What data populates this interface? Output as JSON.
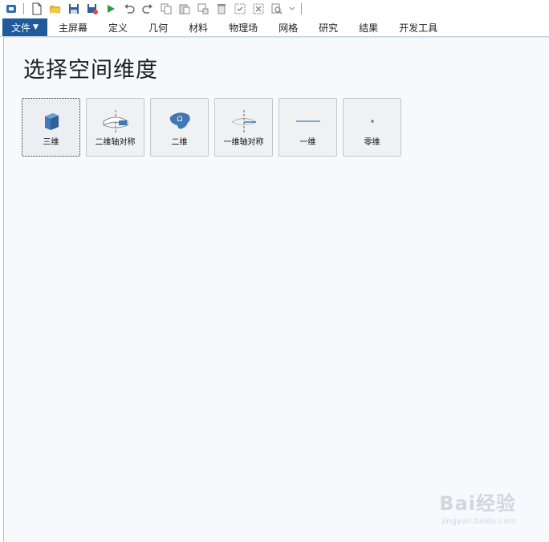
{
  "toolbar": {
    "icons": [
      "app-icon",
      "new-icon",
      "open-icon",
      "save-icon",
      "save-as-icon",
      "run-icon",
      "undo-icon",
      "redo-icon",
      "copy-icon",
      "paste-icon",
      "duplicate-icon",
      "delete-icon",
      "select-all-icon",
      "clear-selection-icon",
      "find-icon",
      "customize-icon"
    ]
  },
  "menubar": {
    "file_label": "文件",
    "tabs": [
      "主屏幕",
      "定义",
      "几何",
      "材料",
      "物理场",
      "网格",
      "研究",
      "结果",
      "开发工具"
    ]
  },
  "page": {
    "title": "选择空间维度"
  },
  "dimensions": [
    {
      "label": "三维",
      "icon": "cube-3d-icon",
      "selected": true
    },
    {
      "label": "二维轴对称",
      "icon": "axisymmetric-2d-icon",
      "selected": false
    },
    {
      "label": "二维",
      "icon": "planar-2d-icon",
      "selected": false
    },
    {
      "label": "一维轴对称",
      "icon": "axisymmetric-1d-icon",
      "selected": false
    },
    {
      "label": "一维",
      "icon": "line-1d-icon",
      "selected": false
    },
    {
      "label": "零维",
      "icon": "point-0d-icon",
      "selected": false
    }
  ],
  "watermark": {
    "brand": "Bai经验",
    "url": "jingyan.baidu.com"
  },
  "colors": {
    "accent": "#1f5a9a",
    "icon_blue": "#3f78b5"
  }
}
